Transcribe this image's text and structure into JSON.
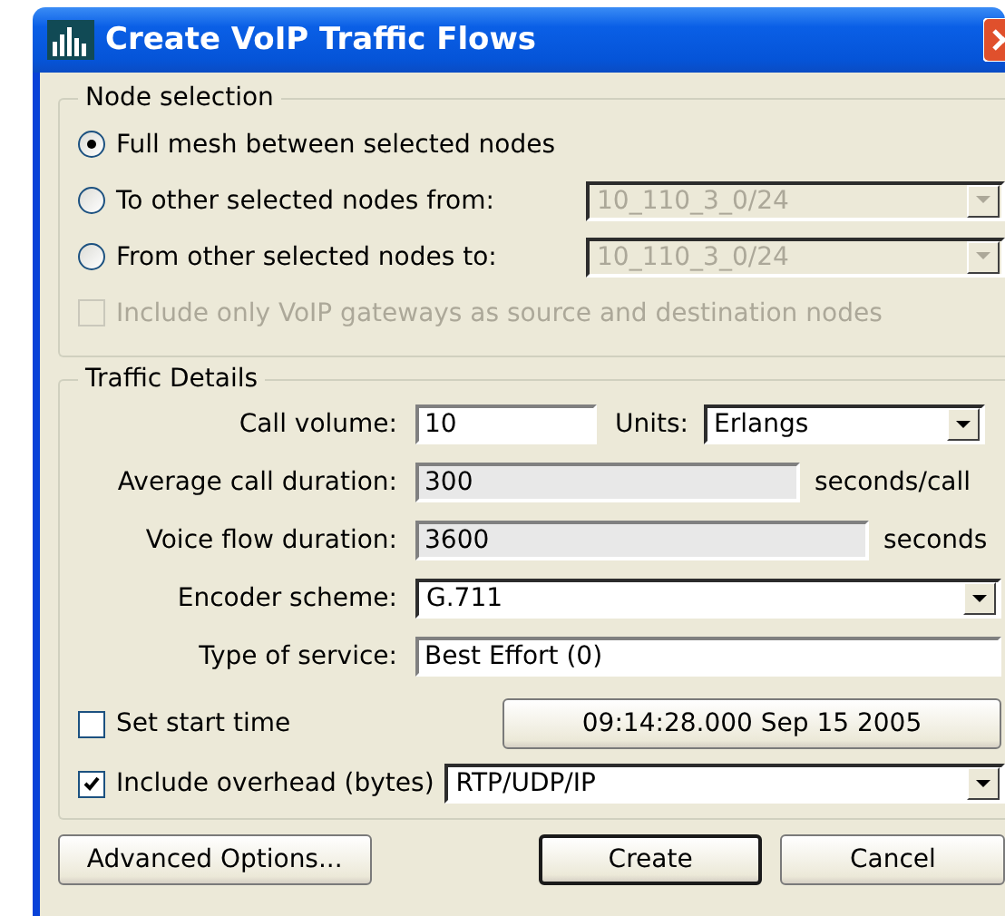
{
  "window": {
    "title": "Create VoIP Traffic Flows"
  },
  "node_selection": {
    "title": "Node selection",
    "options": [
      {
        "label": "Full mesh between selected nodes",
        "selected": true
      },
      {
        "label": "To other selected nodes from:",
        "selected": false,
        "dropdown": {
          "value": "10_110_3_0/24",
          "disabled": true
        }
      },
      {
        "label": "From other selected nodes to:",
        "selected": false,
        "dropdown": {
          "value": "10_110_3_0/24",
          "disabled": true
        }
      }
    ],
    "gateways_only": {
      "label": "Include only VoIP gateways as source and destination nodes",
      "checked": false,
      "disabled": true
    }
  },
  "traffic_details": {
    "title": "Traffic Details",
    "call_volume": {
      "label": "Call volume:",
      "value": "10"
    },
    "units": {
      "label": "Units:",
      "value": "Erlangs"
    },
    "average_call_duration": {
      "label": "Average call duration:",
      "value": "300",
      "unit": "seconds/call",
      "read_only": true
    },
    "voice_flow_duration": {
      "label": "Voice flow duration:",
      "value": "3600",
      "unit": "seconds",
      "read_only": true
    },
    "encoder_scheme": {
      "label": "Encoder scheme:",
      "value": "G.711"
    },
    "type_of_service": {
      "label": "Type of service:",
      "value": "Best Effort (0)"
    },
    "start_time": {
      "label": "Set start time",
      "checked": false,
      "button": "09:14:28.000 Sep 15 2005"
    },
    "overhead": {
      "label": "Include overhead (bytes)",
      "checked": true,
      "value": "RTP/UDP/IP"
    }
  },
  "buttons": [
    {
      "label": "Advanced Options...",
      "default": false
    },
    {
      "label": "Create",
      "default": true
    },
    {
      "label": "Cancel",
      "default": false
    }
  ]
}
